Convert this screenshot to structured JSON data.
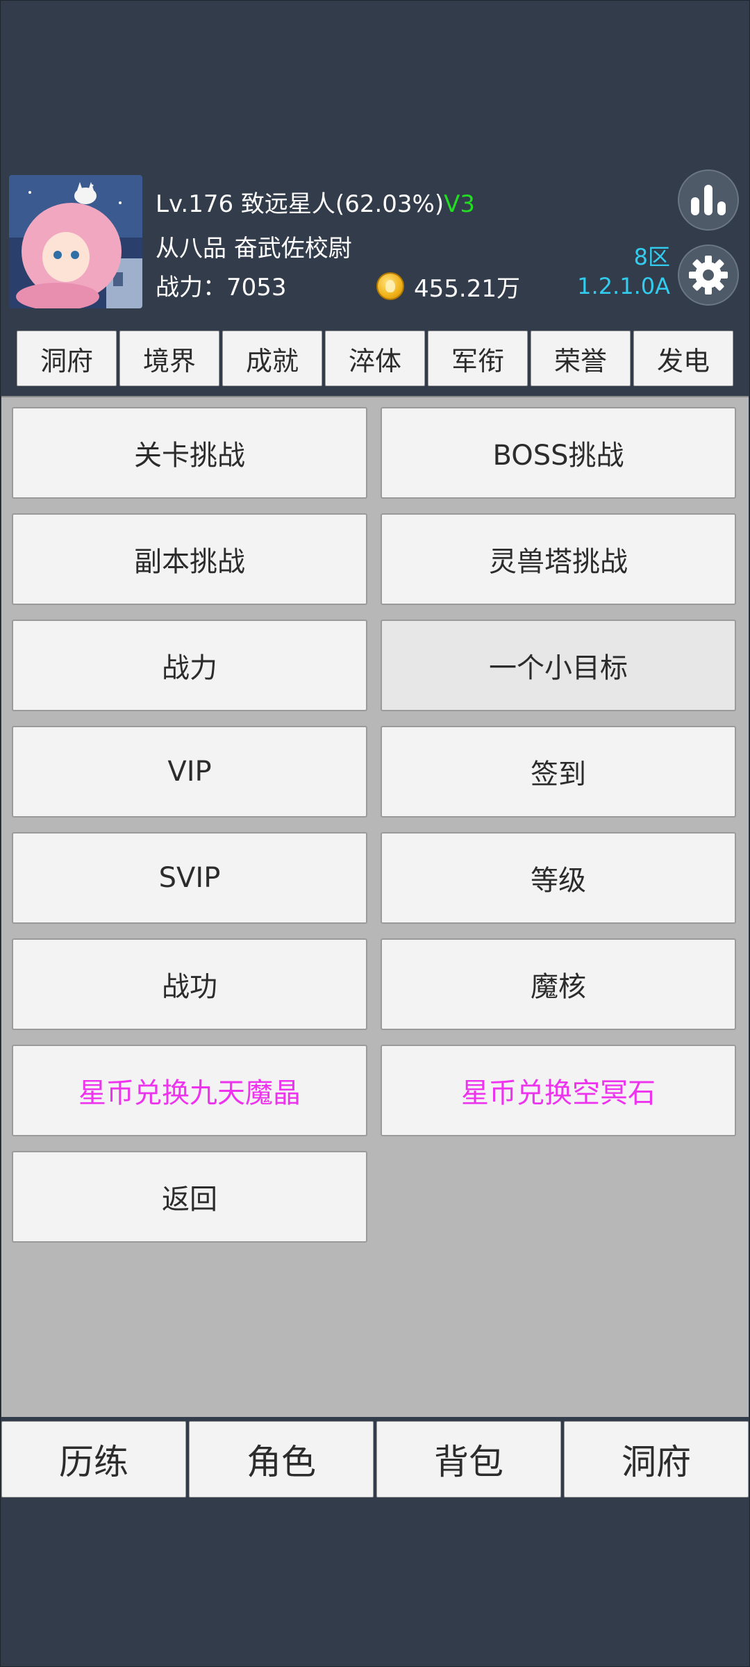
{
  "player": {
    "level_line_prefix": "Lv.176 致远星人(62.03%)",
    "vip_tag": "V3",
    "title": "从八品 奋武佐校尉",
    "power": "战力：7053",
    "coins": "455.21万"
  },
  "server": {
    "zone": "8区",
    "version": "1.2.1.0A"
  },
  "icons": {
    "stats": "bar-chart-icon",
    "settings": "gear-icon",
    "coin": "coin-icon"
  },
  "top_tabs": [
    "洞府",
    "境界",
    "成就",
    "淬体",
    "军衔",
    "荣誉",
    "发电"
  ],
  "menu": [
    {
      "label": "关卡挑战"
    },
    {
      "label": "BOSS挑战"
    },
    {
      "label": "副本挑战"
    },
    {
      "label": "灵兽塔挑战"
    },
    {
      "label": "战力"
    },
    {
      "label": "一个小目标"
    },
    {
      "label": "VIP"
    },
    {
      "label": "签到"
    },
    {
      "label": "SVIP"
    },
    {
      "label": "等级"
    },
    {
      "label": "战功"
    },
    {
      "label": "魔核"
    },
    {
      "label": "星币兑换九天魔晶"
    },
    {
      "label": "星币兑换空冥石"
    },
    {
      "label": "返回"
    }
  ],
  "bottom_nav": [
    "历练",
    "角色",
    "背包",
    "洞府"
  ],
  "colors": {
    "background": "#323c4a",
    "panel": "#b7b7b7",
    "vip_green": "#22dd22",
    "server_cyan": "#33ccee",
    "highlight_magenta": "#ee33ee"
  }
}
